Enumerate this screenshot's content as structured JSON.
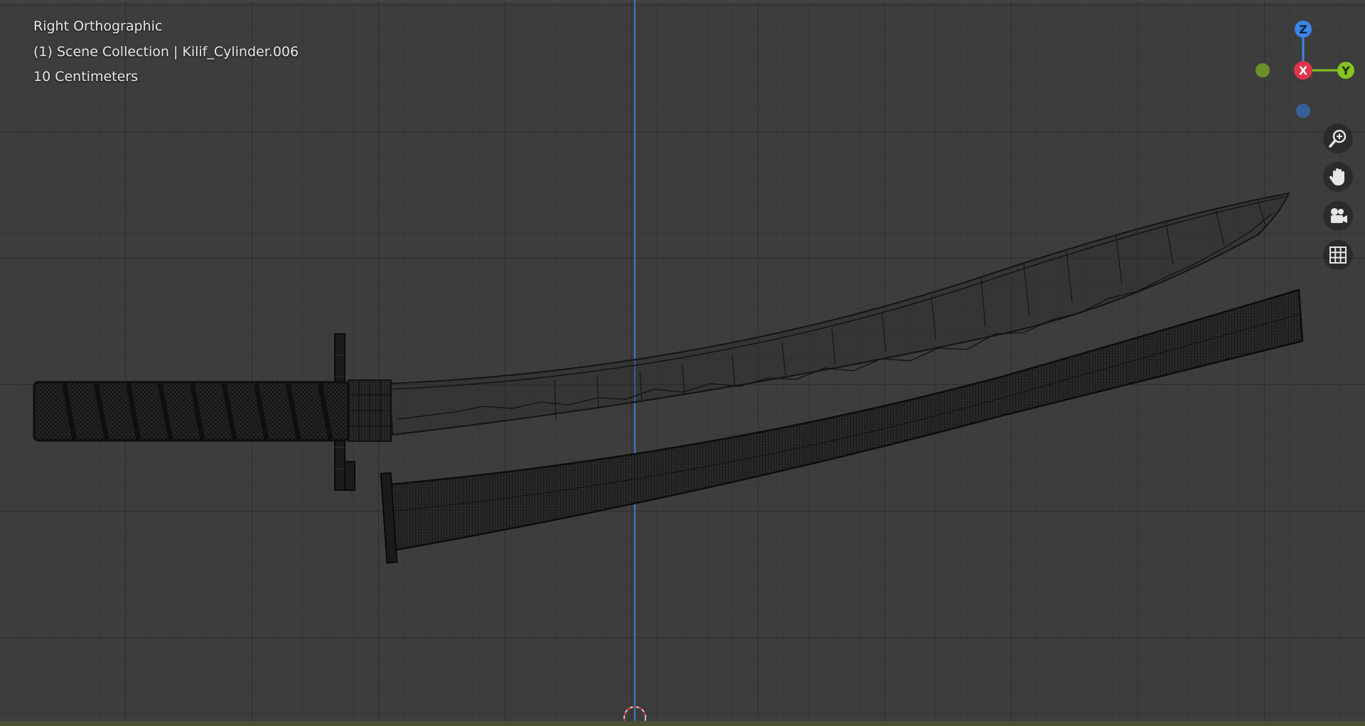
{
  "viewport": {
    "view_name": "Right Orthographic",
    "collection_info": "(1) Scene Collection | Kilif_Cylinder.006",
    "grid_scale": "10 Centimeters"
  },
  "gizmo": {
    "axis_z_label": "Z",
    "axis_x_label": "X",
    "axis_y_label": "Y",
    "color_z": "#3b86e6",
    "color_x": "#e0344c",
    "color_y": "#87c422"
  },
  "nav_tools": [
    {
      "name": "zoom-tool",
      "icon": "zoom-in-icon"
    },
    {
      "name": "pan-tool",
      "icon": "hand-icon"
    },
    {
      "name": "camera-view-tool",
      "icon": "camera-icon"
    },
    {
      "name": "ortho-toggle-tool",
      "icon": "grid-icon"
    }
  ],
  "colors": {
    "background": "#3d3d3d",
    "vertical_axis": "#3f77c9",
    "wire": "#121212"
  }
}
